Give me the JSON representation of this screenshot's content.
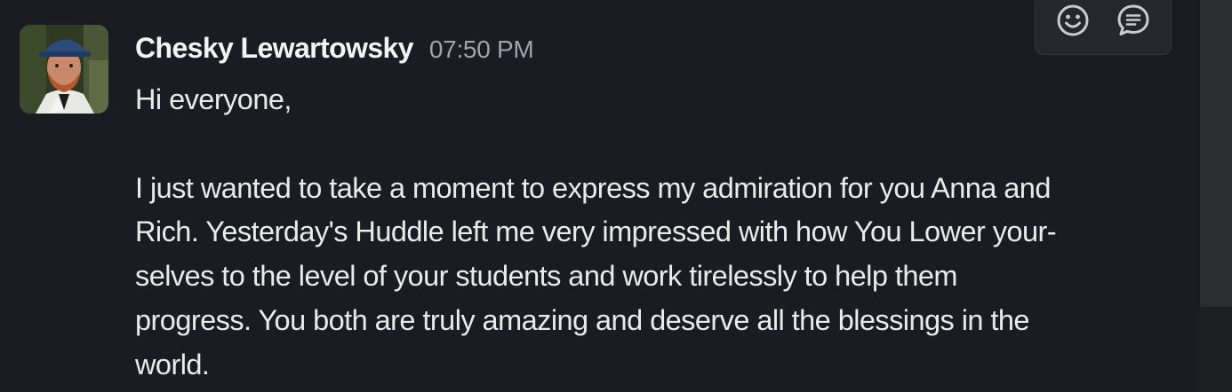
{
  "message": {
    "author": "Chesky Lewartowsky",
    "time": "07:50 PM",
    "body": "Hi everyone,\n\nI just wanted to take a moment to express my admiration for you Anna and\nRich. Yesterday's Huddle left me very impressed with how You Lower your-\nselves to the level of your students and work tirelessly to help them\nprogress. You both are truly amazing and deserve all the blessings in the\nworld.",
    "avatar_icon": "user-photo"
  },
  "toolbar": {
    "react_icon": "smiley-icon",
    "thread_icon": "speech-bubble-icon"
  },
  "colors": {
    "background": "#1a1c22",
    "author": "#f2f3f5",
    "time": "#a0a3a9",
    "text": "#e9eaec"
  }
}
